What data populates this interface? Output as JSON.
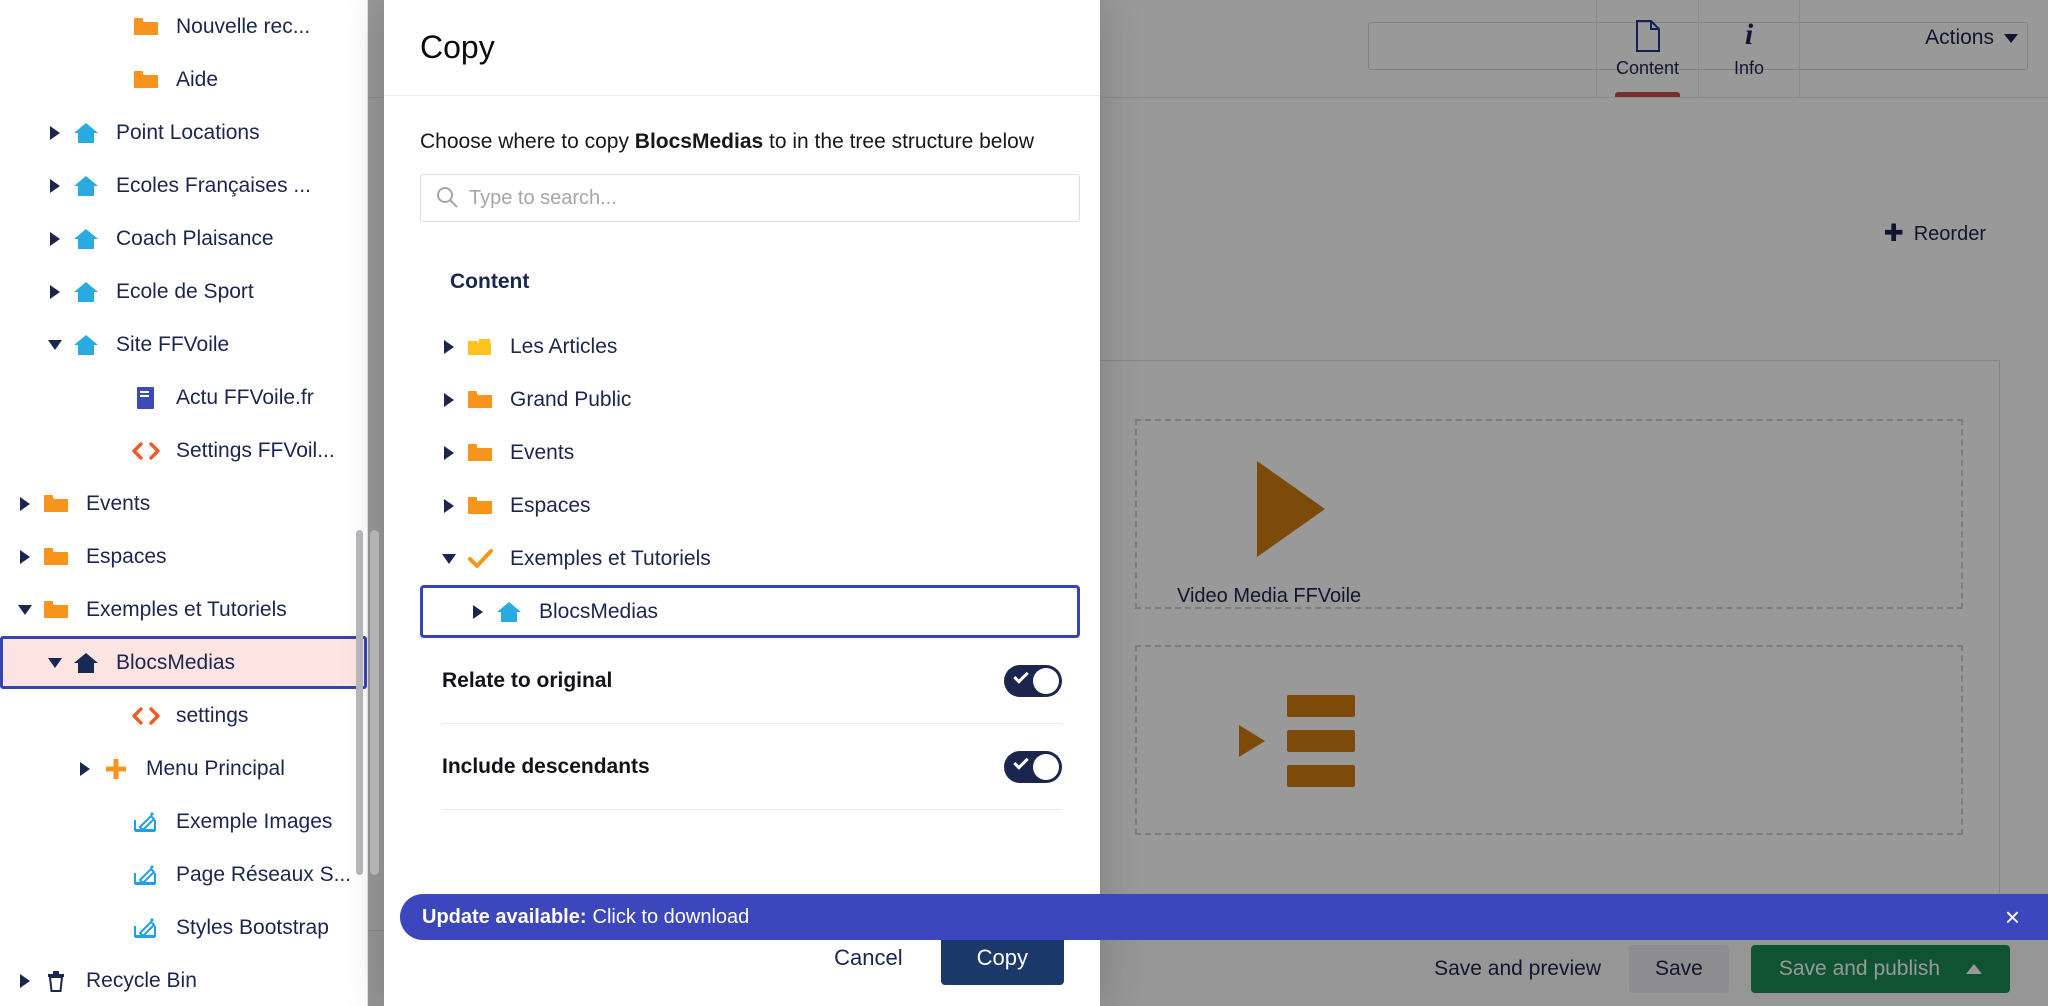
{
  "sidebar": {
    "items": [
      {
        "label": "Nouvelle rec...",
        "icon": "folder-icon",
        "arrow": "none",
        "indent": 2,
        "state": "normal"
      },
      {
        "label": "Aide",
        "icon": "folder-icon",
        "arrow": "none",
        "indent": 2,
        "state": "normal"
      },
      {
        "label": "Point Locations",
        "icon": "home-icon",
        "arrow": "right",
        "indent": 0,
        "state": "normal"
      },
      {
        "label": "Ecoles Françaises ...",
        "icon": "home-icon",
        "arrow": "right",
        "indent": 0,
        "state": "normal"
      },
      {
        "label": "Coach Plaisance",
        "icon": "home-icon",
        "arrow": "right",
        "indent": 0,
        "state": "normal"
      },
      {
        "label": "Ecole de Sport",
        "icon": "home-icon",
        "arrow": "right",
        "indent": 0,
        "state": "normal"
      },
      {
        "label": "Site FFVoile",
        "icon": "home-icon",
        "arrow": "down",
        "indent": 0,
        "state": "normal"
      },
      {
        "label": "Actu FFVoile.fr",
        "icon": "book-icon",
        "arrow": "none",
        "indent": 2,
        "state": "normal"
      },
      {
        "label": "Settings FFVoil...",
        "icon": "code-icon",
        "arrow": "none",
        "indent": 2,
        "state": "normal"
      },
      {
        "label": "Events",
        "icon": "folder-icon",
        "arrow": "right",
        "indent": -1,
        "state": "normal"
      },
      {
        "label": "Espaces",
        "icon": "folder-icon",
        "arrow": "right",
        "indent": -1,
        "state": "normal"
      },
      {
        "label": "Exemples et Tutoriels",
        "icon": "folder-icon",
        "arrow": "down",
        "indent": -1,
        "state": "normal"
      },
      {
        "label": "BlocsMedias",
        "icon": "home-dark-icon",
        "arrow": "down",
        "indent": 0,
        "state": "selected"
      },
      {
        "label": "settings",
        "icon": "code-icon",
        "arrow": "none",
        "indent": 2,
        "state": "normal"
      },
      {
        "label": "Menu Principal",
        "icon": "plus-icon",
        "arrow": "right",
        "indent": 1,
        "state": "normal"
      },
      {
        "label": "Exemple Images",
        "icon": "doc-edit-icon",
        "arrow": "none",
        "indent": 2,
        "state": "normal"
      },
      {
        "label": "Page Réseaux S...",
        "icon": "doc-edit-icon",
        "arrow": "none",
        "indent": 2,
        "state": "normal"
      },
      {
        "label": "Styles Bootstrap",
        "icon": "doc-edit-icon",
        "arrow": "none",
        "indent": 2,
        "state": "normal"
      },
      {
        "label": "Recycle Bin",
        "icon": "trash-icon",
        "arrow": "right",
        "indent": -1,
        "state": "normal"
      }
    ]
  },
  "modal": {
    "title": "Copy",
    "helper_prefix": "Choose where to copy ",
    "helper_target": "BlocsMedias",
    "helper_suffix": " to in the tree structure below",
    "search_placeholder": "Type to search...",
    "search_value": "",
    "tree_heading": "Content",
    "tree": [
      {
        "label": "Les Articles",
        "icon": "folder-open-icon",
        "arrow": "right",
        "state": "normal"
      },
      {
        "label": "Grand Public",
        "icon": "folder-icon",
        "arrow": "right",
        "state": "normal"
      },
      {
        "label": "Events",
        "icon": "folder-icon",
        "arrow": "right",
        "state": "normal"
      },
      {
        "label": "Espaces",
        "icon": "folder-icon",
        "arrow": "right",
        "state": "normal"
      },
      {
        "label": "Exemples et Tutoriels",
        "icon": "check-icon",
        "arrow": "down",
        "state": "normal"
      },
      {
        "label": "BlocsMedias",
        "icon": "home-icon",
        "arrow": "right",
        "state": "selected"
      }
    ],
    "toggles": [
      {
        "label": "Relate to original",
        "on": true
      },
      {
        "label": "Include descendants",
        "on": true
      }
    ],
    "cancel_label": "Cancel",
    "copy_label": "Copy"
  },
  "notification": {
    "strong": "Update available:",
    "text": " Click to download",
    "close": "×"
  },
  "editor": {
    "tabs": [
      {
        "label": "Content",
        "icon": "document-icon",
        "active": true
      },
      {
        "label": "Info",
        "icon": "info-icon",
        "active": false
      }
    ],
    "actions_label": "Actions",
    "reorder_label": "Reorder",
    "reorder_icon": "plus-icon",
    "blocks": [
      {
        "label": "Video Media FFVoile",
        "kind": "video"
      },
      {
        "label": "",
        "kind": "list"
      }
    ],
    "footer": {
      "save_and_preview": "Save and preview",
      "save": "Save",
      "save_and_publish": "Save and publish"
    }
  },
  "colors": {
    "accent_orange": "#f7941d",
    "accent_blue": "#29abe2",
    "select_border": "#3544b3",
    "select_bg": "#fbe4e2",
    "primary_dark": "#1b264f",
    "notify_bg": "#3c46bd",
    "publish_green": "#1a8a52"
  }
}
